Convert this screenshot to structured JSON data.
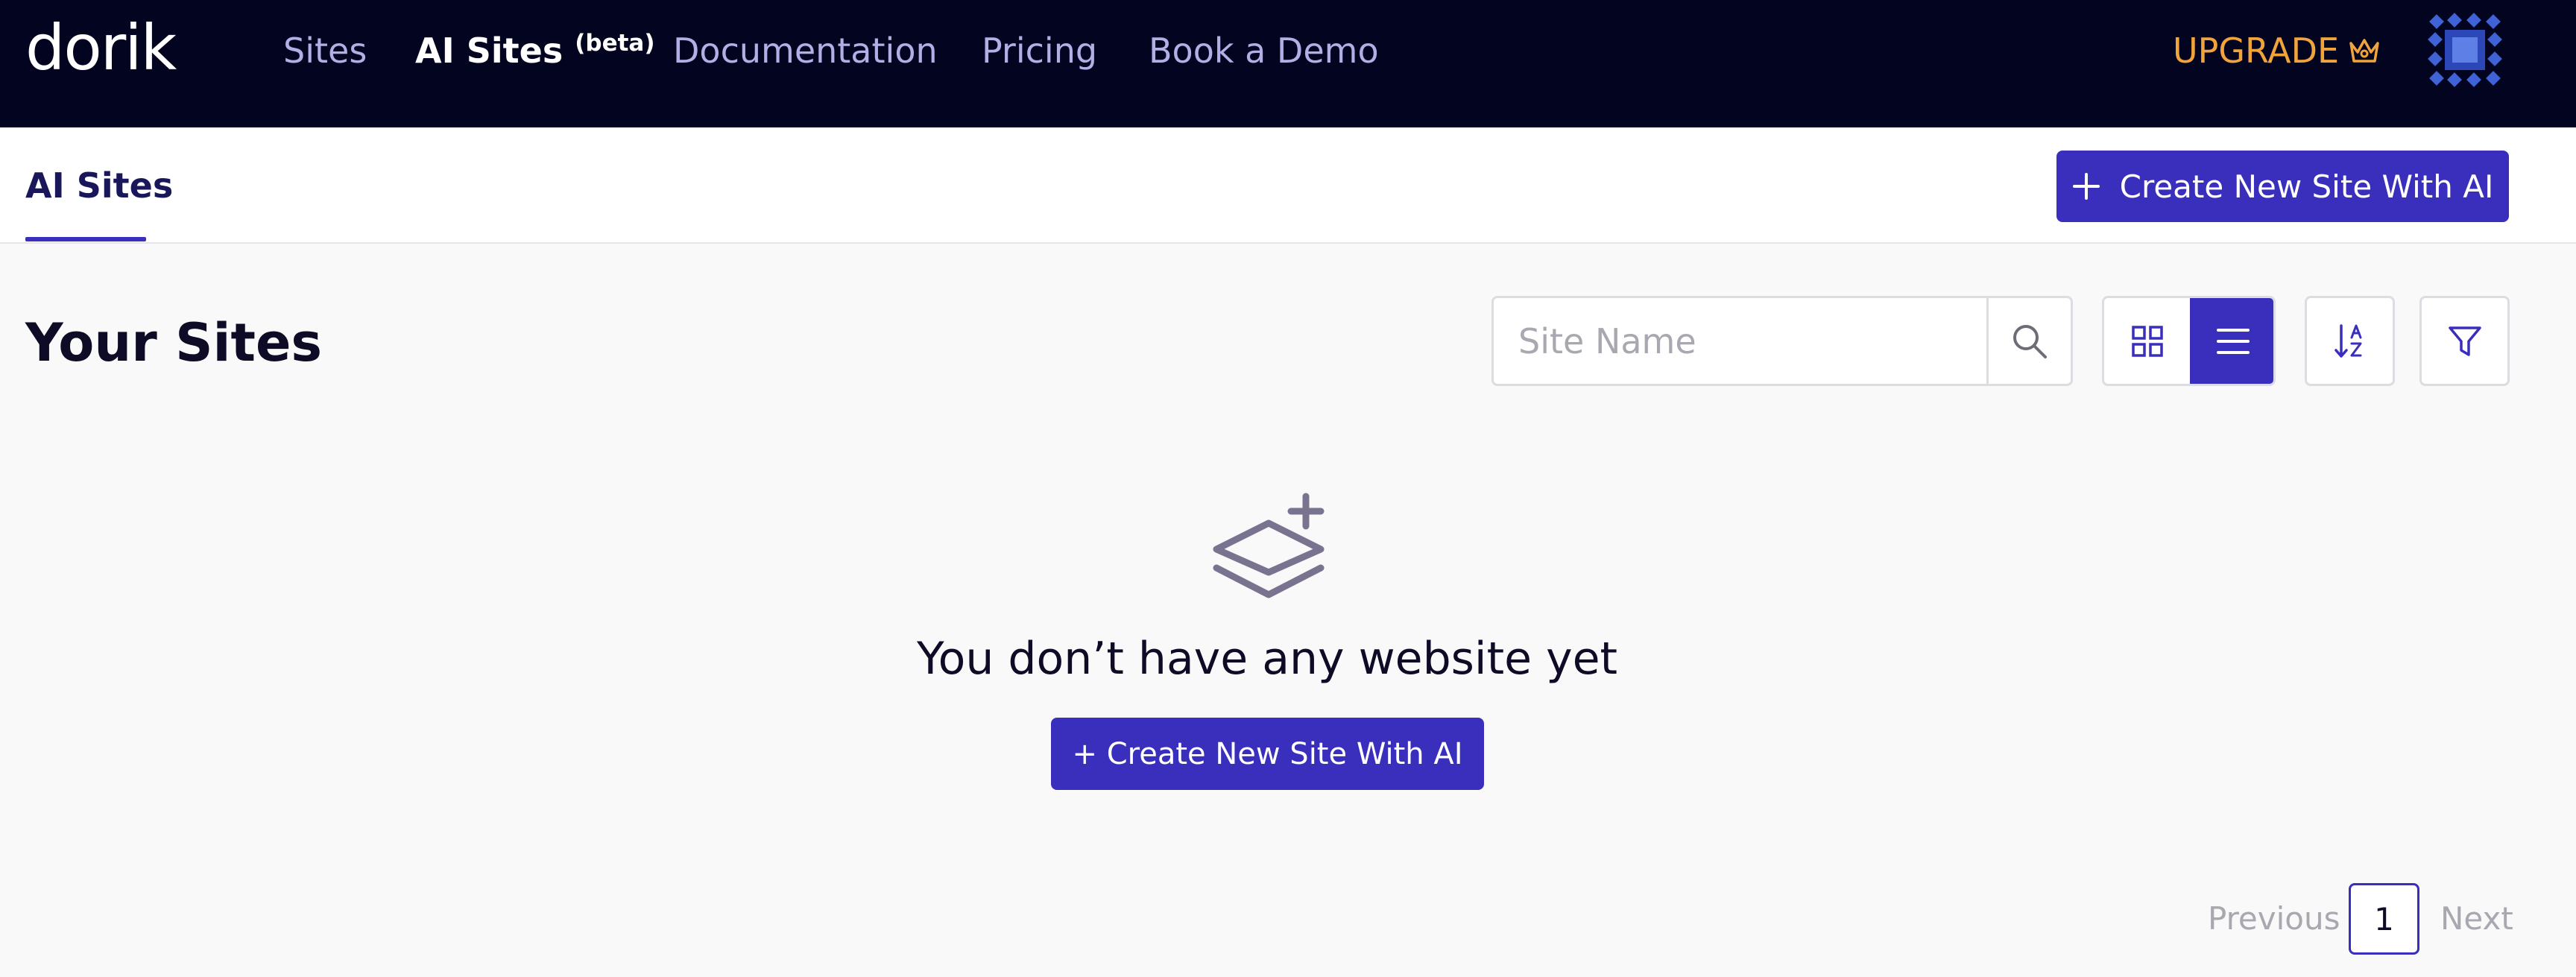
{
  "brand": {
    "logo_text": "dorik"
  },
  "nav": {
    "items": [
      {
        "label": "Sites"
      },
      {
        "label": "AI Sites",
        "badge": "(beta)"
      },
      {
        "label": "Documentation"
      },
      {
        "label": "Pricing"
      },
      {
        "label": "Book a Demo"
      }
    ],
    "upgrade_label": "UPGRADE"
  },
  "tabs": {
    "active_label": "AI Sites"
  },
  "toolbar": {
    "create_label": "Create New Site With AI"
  },
  "main": {
    "title": "Your Sites",
    "search_placeholder": "Site Name",
    "empty_message": "You don’t have any website yet",
    "create_label": "+ Create New Site With AI"
  },
  "pagination": {
    "previous_label": "Previous",
    "current_page": "1",
    "next_label": "Next"
  },
  "icons": {
    "upgrade": "crown-icon",
    "search": "search-icon",
    "grid_view": "grid-view-icon",
    "list_view": "list-view-icon",
    "sort": "sort-az-icon",
    "filter": "filter-icon",
    "empty_state": "layers-plus-icon"
  },
  "colors": {
    "nav_bg": "#03041f",
    "accent": "#3a2fbd",
    "upgrade": "#f1a33c",
    "nav_link": "#b4aee6"
  }
}
